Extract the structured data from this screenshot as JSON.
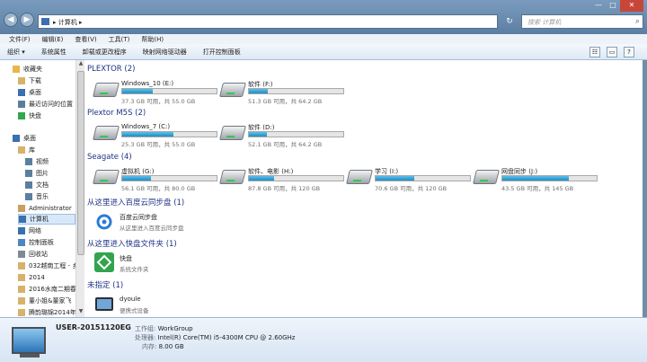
{
  "window": {
    "breadcrumb_sep": "▸",
    "address": "计算机",
    "search_placeholder": "搜索 计算机",
    "btn_min": "—",
    "btn_max": "□",
    "btn_close": "✕",
    "back": "◀",
    "forward": "▶",
    "refresh": "↻"
  },
  "menu": [
    {
      "label": "文件(F)"
    },
    {
      "label": "编辑(E)"
    },
    {
      "label": "查看(V)"
    },
    {
      "label": "工具(T)"
    },
    {
      "label": "帮助(H)"
    }
  ],
  "toolbar": {
    "organize": "组织 ▾",
    "system_properties": "系统属性",
    "uninstall": "卸载或更改程序",
    "map_drive": "映射网络驱动器",
    "control_panel": "打开控制面板",
    "view_icon": "☷",
    "pane_icon": "▭",
    "help_icon": "?"
  },
  "sidebar": [
    {
      "label": "收藏夹",
      "icon": "star-icon",
      "color": "#e8b64a"
    },
    {
      "label": "下载",
      "icon": "folder-icon",
      "color": "#d8b26a"
    },
    {
      "label": "桌面",
      "icon": "desktop-icon",
      "color": "#3a6fb0"
    },
    {
      "label": "最近访问的位置",
      "icon": "recent-icon",
      "color": "#5c7d9e"
    },
    {
      "label": "快盘",
      "icon": "kuaipan-icon",
      "color": "#2fa84f"
    },
    {
      "label": "桌面",
      "icon": "desktop-icon",
      "color": "#3a6fb0"
    },
    {
      "label": "库",
      "icon": "library-icon",
      "color": "#d8b26a"
    },
    {
      "label": "视频",
      "icon": "video-icon",
      "color": "#5a7fa0"
    },
    {
      "label": "图片",
      "icon": "picture-icon",
      "color": "#5a7fa0"
    },
    {
      "label": "文档",
      "icon": "document-icon",
      "color": "#5a7fa0"
    },
    {
      "label": "音乐",
      "icon": "music-icon",
      "color": "#5a7fa0"
    },
    {
      "label": "Administrator",
      "icon": "user-icon",
      "color": "#c8a060"
    },
    {
      "label": "计算机",
      "icon": "computer-icon",
      "color": "#3a6fb0"
    },
    {
      "label": "网络",
      "icon": "network-icon",
      "color": "#3a6fb0"
    },
    {
      "label": "控制面板",
      "icon": "control-panel-icon",
      "color": "#4b87c5"
    },
    {
      "label": "回收站",
      "icon": "recycle-bin-icon",
      "color": "#7d8a96"
    },
    {
      "label": "032越南工程 - 乡",
      "icon": "folder-icon",
      "color": "#d8b26a"
    },
    {
      "label": "2014",
      "icon": "folder-icon",
      "color": "#d8b26a"
    },
    {
      "label": "2016水南二期春",
      "icon": "folder-icon",
      "color": "#d8b26a"
    },
    {
      "label": "董小姐&董家飞",
      "icon": "folder-icon",
      "color": "#d8b26a"
    },
    {
      "label": "腾韵璐锦2014年",
      "icon": "folder-icon",
      "color": "#d8b26a"
    }
  ],
  "groups": {
    "g1": "PLEXTOR (2)",
    "g2": "Plextor M5S (2)",
    "g3": "Seagate (4)",
    "g4": "从这里进入百度云同步盘 (1)",
    "g5": "从这里进入快盘文件夹 (1)",
    "g6": "未指定 (1)"
  },
  "drives": [
    {
      "name": "Windows_10 (E:)",
      "info": "37.3 GB 可用，共 55.0 GB",
      "used_fraction": 0.32
    },
    {
      "name": "软件 (F:)",
      "info": "51.3 GB 可用，共 64.2 GB",
      "used_fraction": 0.2
    },
    {
      "name": "Windows_7 (C:)",
      "info": "25.3 GB 可用，共 55.0 GB",
      "used_fraction": 0.54
    },
    {
      "name": "软件 (D:)",
      "info": "52.1 GB 可用，共 64.2 GB",
      "used_fraction": 0.19
    },
    {
      "name": "虚拟机 (G:)",
      "info": "56.1 GB 可用，共 80.0 GB",
      "used_fraction": 0.3
    },
    {
      "name": "软件、电影 (H:)",
      "info": "87.8 GB 可用，共 120 GB",
      "used_fraction": 0.27
    },
    {
      "name": "学习 (I:)",
      "info": "70.6 GB 可用，共 120 GB",
      "used_fraction": 0.41
    },
    {
      "name": "网盘同步 (J:)",
      "info": "43.5 GB 可用，共 145 GB",
      "used_fraction": 0.7
    }
  ],
  "baidu": {
    "name": "百度云同步盘",
    "desc": "从这里进入百度云同步盘"
  },
  "kuaipan": {
    "name": "快盘",
    "desc": "系统文件夹"
  },
  "device": {
    "name": "dyoule",
    "desc": "便携式设备"
  },
  "details": {
    "pc_name": "USER-20151120EG",
    "workgroup_label": "工作组:",
    "workgroup": "WorkGroup",
    "cpu_label": "处理器:",
    "cpu": "Intel(R) Core(TM) i5-4300M CPU @ 2.60GHz",
    "mem_label": "内存:",
    "mem": "8.00 GB"
  }
}
